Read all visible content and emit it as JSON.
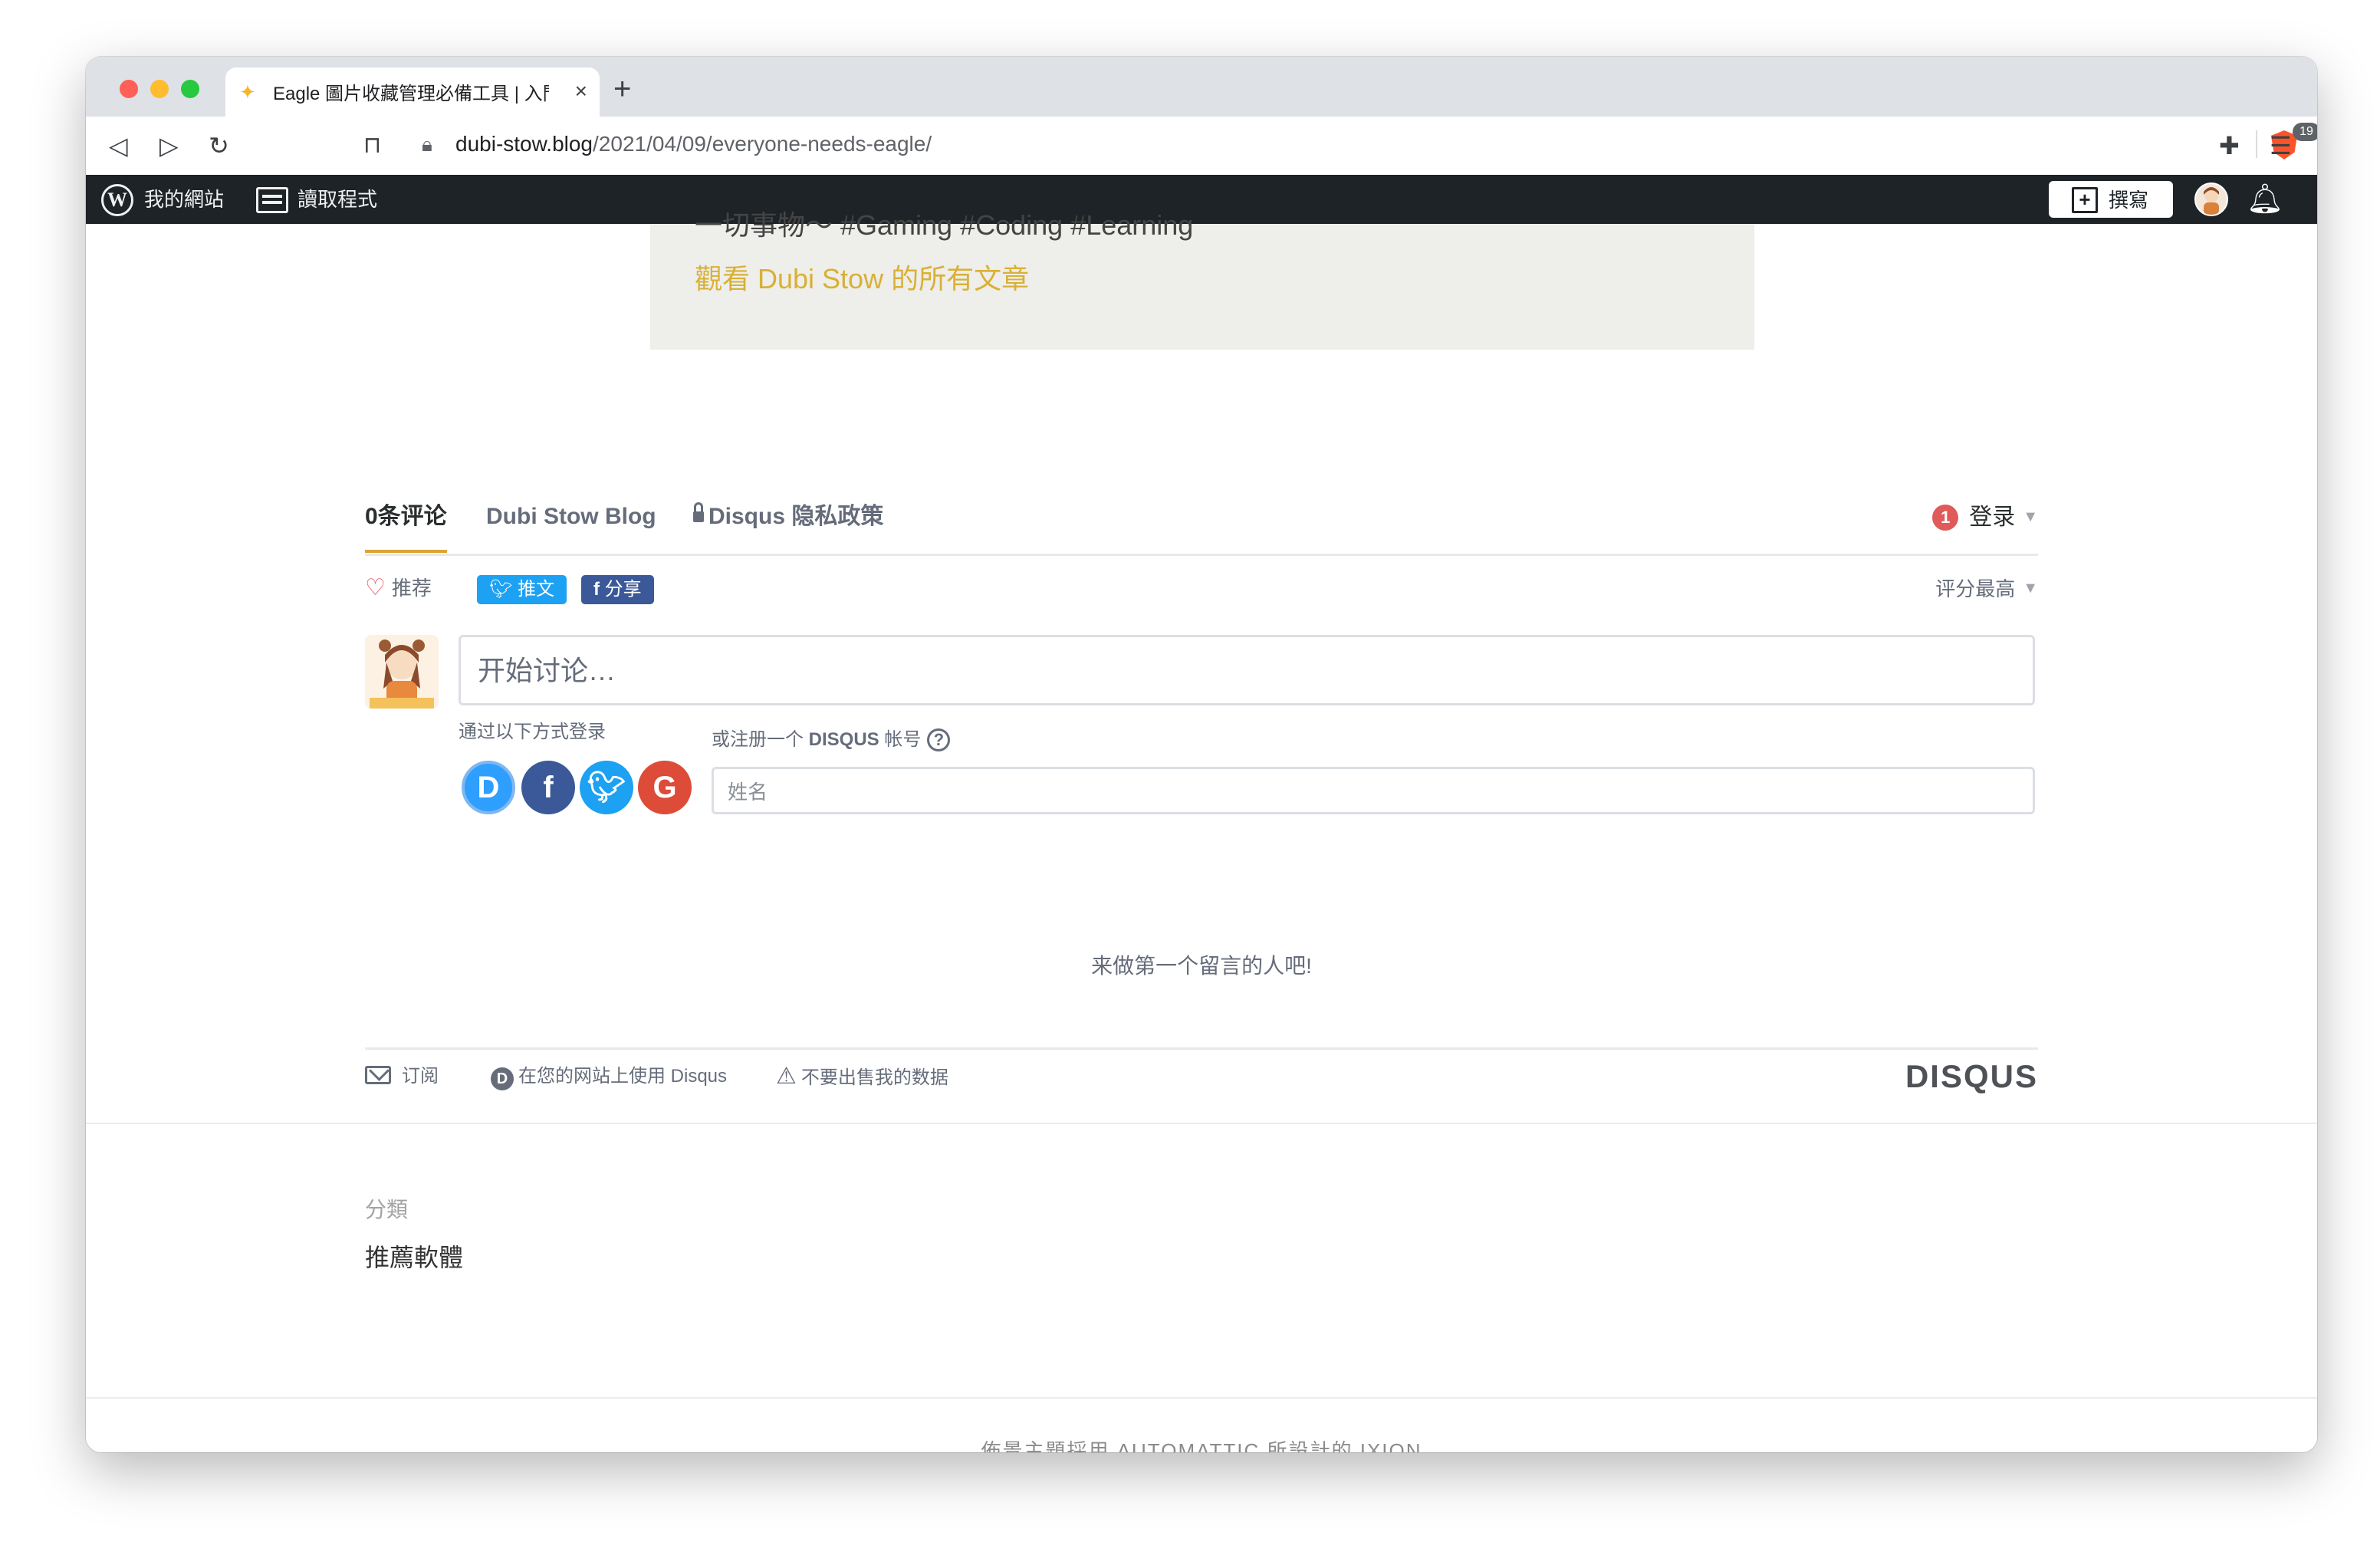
{
  "browser": {
    "tab_title": "Eagle 圖片收藏管理必備工具 | 入門",
    "tab_close": "×",
    "new_tab": "+",
    "url_host": "dubi-stow.blog",
    "url_path": "/2021/04/09/everyone-needs-eagle/",
    "shield_count": "19"
  },
  "wp_admin_bar": {
    "my_site": "我的網站",
    "reader": "讀取程式",
    "write": "撰寫"
  },
  "author_box": {
    "bio_tail": "一切事物～ #Gaming #Coding #Learning",
    "view_all_posts": "觀看 Dubi Stow 的所有文章"
  },
  "disqus": {
    "tabs": {
      "comments": "0条评论",
      "community": "Dubi Stow Blog",
      "privacy": "Disqus 隐私政策"
    },
    "notification_count": "1",
    "login": "登录",
    "recommend": "推荐",
    "tweet": "推文",
    "share": "分享",
    "sort": "评分最高",
    "comment_placeholder": "开始讨论…",
    "login_with": "通过以下方式登录",
    "register_prefix": "或注册一个",
    "register_brand": "DISQUS",
    "register_suffix": "帐号",
    "name_placeholder": "姓名",
    "empty_message": "来做第一个留言的人吧!",
    "footer": {
      "subscribe": "订阅",
      "use_disqus": "在您的网站上使用 Disqus",
      "do_not_sell": "不要出售我的数据"
    },
    "brand": "DISQUS"
  },
  "post_meta": {
    "category_label": "分類",
    "category_value": "推薦軟體"
  },
  "site_footer": {
    "credit": "佈景主題採用 AUTOMATTIC 所設計的 IXION"
  }
}
